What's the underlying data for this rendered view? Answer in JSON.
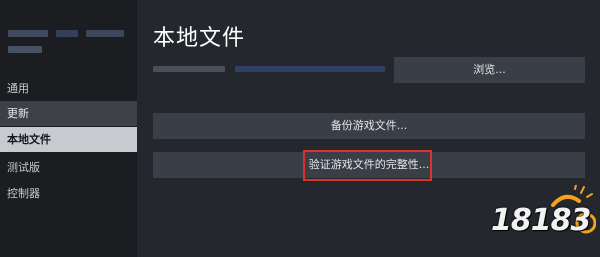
{
  "sidebar": {
    "items": [
      {
        "label": "通用",
        "state": "normal"
      },
      {
        "label": "更新",
        "state": "hovered"
      },
      {
        "label": "本地文件",
        "state": "active"
      },
      {
        "label": "测试版",
        "state": "normal"
      },
      {
        "label": "控制器",
        "state": "normal"
      }
    ]
  },
  "main": {
    "title": "本地文件",
    "browse_button": "浏览...",
    "backup_button": "备份游戏文件...",
    "verify_button": "验证游戏文件的完整性..."
  },
  "watermark": {
    "logo_text": "18183"
  },
  "colors": {
    "background": "#24272d",
    "sidebar": "#1b1d21",
    "active_item": "#c7cacf",
    "button": "#3a3f47",
    "highlight": "#d9342b"
  }
}
